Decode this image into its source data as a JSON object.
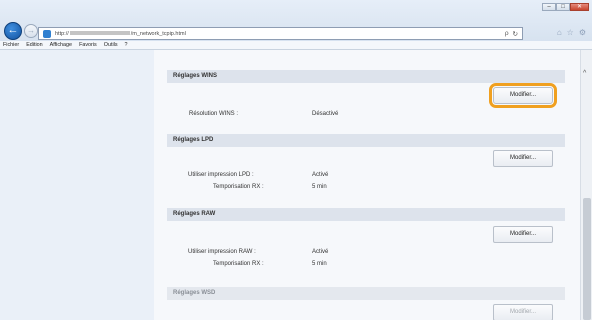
{
  "window": {
    "minimize": "–",
    "maximize": "□",
    "close": "✕"
  },
  "address_bar": {
    "url": "http://",
    "url_tail": "/m_network_tcpip.html",
    "search_symbol": "ρ",
    "refresh_symbol": "↻"
  },
  "menu": [
    "Fichier",
    "Edition",
    "Affichage",
    "Favoris",
    "Outils",
    "?"
  ],
  "sections": {
    "wins": {
      "title": "Réglages WINS",
      "button": "Modifier...",
      "rows": [
        {
          "label": "Résolution WINS :",
          "value": "Désactivé"
        }
      ]
    },
    "lpd": {
      "title": "Réglages LPD",
      "button": "Modifier...",
      "rows": [
        {
          "label": "Utiliser impression LPD :",
          "value": "Activé"
        },
        {
          "label": "Temporisation RX :",
          "value": "5 min"
        }
      ]
    },
    "raw": {
      "title": "Réglages RAW",
      "button": "Modifier...",
      "rows": [
        {
          "label": "Utiliser impression RAW :",
          "value": "Activé"
        },
        {
          "label": "Temporisation RX :",
          "value": "5 min"
        }
      ]
    },
    "wsd": {
      "title": "Réglages WSD",
      "button": "Modifier..."
    }
  },
  "colors": {
    "highlight": "#f0a020",
    "sidebar_bg": "#eaf0f8",
    "section_header_bg": "#dde3ec"
  }
}
